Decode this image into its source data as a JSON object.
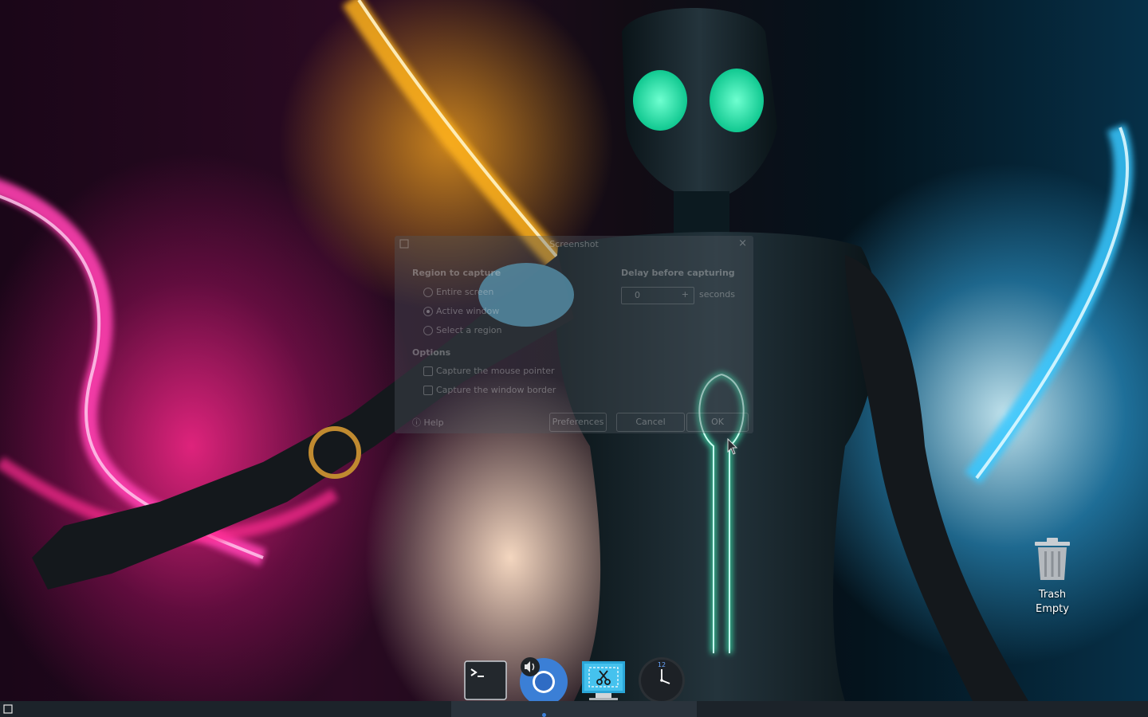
{
  "desktop": {
    "trash": {
      "title": "Trash",
      "status": "Empty",
      "icon": "trash-icon"
    }
  },
  "dialog": {
    "title": "Screenshot",
    "app_icon": "screenshot-app-icon",
    "region_heading": "Region to capture",
    "region_options": [
      "Entire screen",
      "Active window",
      "Select a region"
    ],
    "region_selected": "Active window",
    "delay_heading": "Delay before capturing",
    "delay_value": "0",
    "delay_unit": "seconds",
    "options_heading": "Options",
    "options": [
      "Capture the mouse pointer",
      "Capture the window border"
    ],
    "buttons": {
      "help": "Help",
      "preferences": "Preferences",
      "cancel": "Cancel",
      "ok": "OK"
    }
  },
  "dock": {
    "items": [
      {
        "name": "terminal",
        "icon": "terminal-icon"
      },
      {
        "name": "chromium",
        "icon": "chromium-icon",
        "badge": "speaker-icon"
      },
      {
        "name": "screenshot",
        "icon": "screenshot-icon"
      },
      {
        "name": "clock",
        "icon": "clock-icon",
        "clock_number": "12"
      }
    ]
  },
  "taskbar": {
    "start_icon": "show-desktop-icon"
  },
  "colors": {
    "taskbar": "#1c232a",
    "active_indicator": "#3d7fd8"
  }
}
